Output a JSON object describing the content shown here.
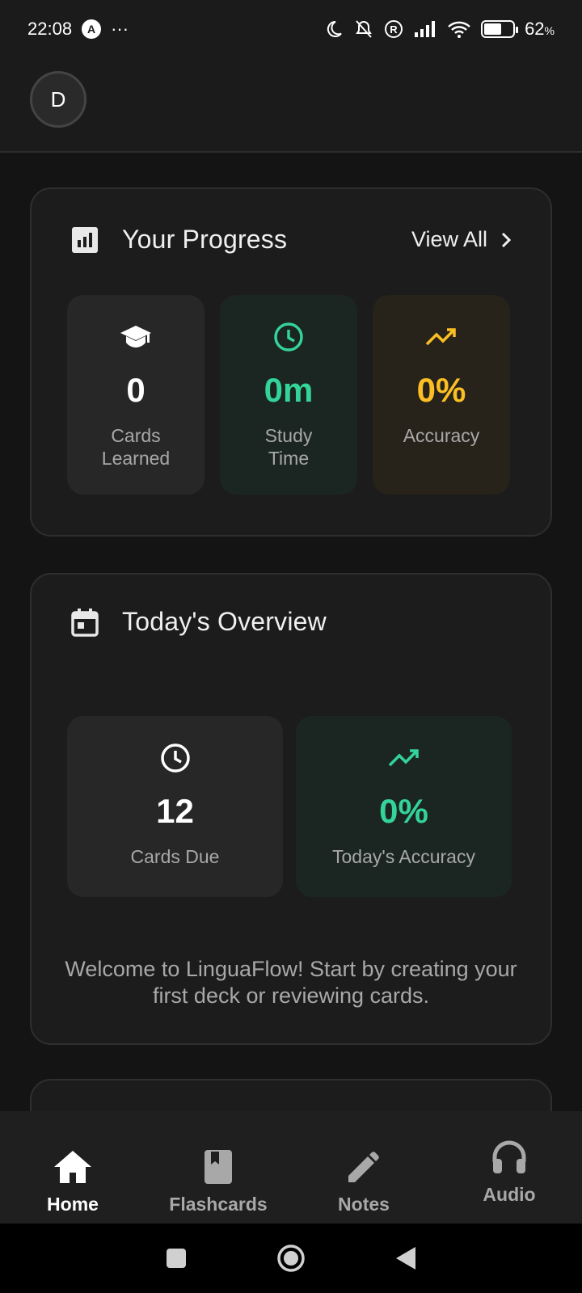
{
  "status_bar": {
    "time": "22:08",
    "notification_letter": "A",
    "more": "···",
    "battery_percent": "62",
    "battery_symbol": "%",
    "battery_level": 0.62
  },
  "header": {
    "avatar_initial": "D"
  },
  "progress": {
    "title": "Your Progress",
    "view_all_label": "View All",
    "tiles": [
      {
        "icon": "graduation-cap-icon",
        "value": "0",
        "label": "Cards Learned",
        "value_color": "#ffffff"
      },
      {
        "icon": "clock-icon",
        "value": "0m",
        "label": "Study Time",
        "value_color": "#34d399"
      },
      {
        "icon": "trending-up-icon",
        "value": "0%",
        "label": "Accuracy",
        "value_color": "#fbbf24"
      }
    ]
  },
  "overview": {
    "title": "Today's Overview",
    "tiles": [
      {
        "icon": "clock-icon",
        "value": "12",
        "label": "Cards Due",
        "value_color": "#ffffff"
      },
      {
        "icon": "trending-up-icon",
        "value": "0%",
        "label": "Today's Accuracy",
        "value_color": "#34d399"
      }
    ],
    "welcome_message": "Welcome to LinguaFlow! Start by creating your first deck or reviewing cards."
  },
  "bottom_nav": {
    "items": [
      {
        "label": "Home",
        "icon": "home-icon",
        "active": true
      },
      {
        "label": "Flashcards",
        "icon": "book-icon",
        "active": false
      },
      {
        "label": "Notes",
        "icon": "pencil-icon",
        "active": false
      },
      {
        "label": "Audio",
        "icon": "headphones-icon",
        "active": false
      }
    ]
  },
  "colors": {
    "accent_green": "#34d399",
    "accent_amber": "#fbbf24",
    "card_bg": "#1c1c1c",
    "tile_neutral_bg": "#272727",
    "tile_green_bg": "#1b2622",
    "tile_amber_bg": "#27221a"
  }
}
